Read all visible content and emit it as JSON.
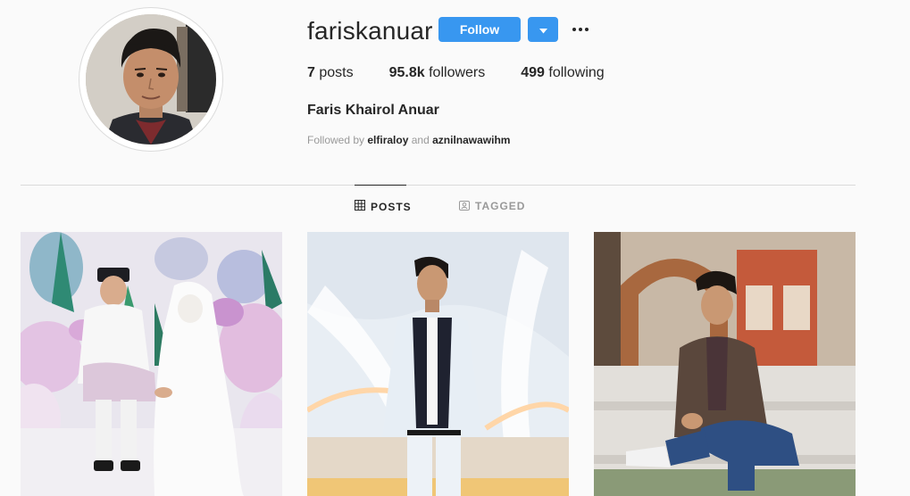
{
  "profile": {
    "username": "fariskanuar",
    "full_name": "Faris Khairol Anuar",
    "avatar_alt": "fariskanuar profile picture"
  },
  "actions": {
    "follow_label": "Follow",
    "dropdown_icon": "caret-down-icon",
    "more_icon": "more-options-icon"
  },
  "stats": {
    "posts_count": "7",
    "posts_label": "posts",
    "followers_count": "95.8k",
    "followers_label": "followers",
    "following_count": "499",
    "following_label": "following"
  },
  "followed_by": {
    "prefix": "Followed by",
    "user1": "elfiraloy",
    "conjunction": "and",
    "user2": "aznilnawawihm"
  },
  "tabs": [
    {
      "label": "POSTS",
      "icon": "grid-icon",
      "active": true
    },
    {
      "label": "TAGGED",
      "icon": "tag-icon",
      "active": false
    }
  ],
  "posts": [
    {
      "alt": "Wedding photo of couple in white attire with floral backdrop"
    },
    {
      "alt": "Man in white suit posing in front of white structure"
    },
    {
      "alt": "Man in leather jacket sitting on steps"
    }
  ],
  "colors": {
    "accent": "#3897f0",
    "background": "#fafafa",
    "text": "#262626",
    "muted": "#999999",
    "border": "#dbdbdb"
  }
}
